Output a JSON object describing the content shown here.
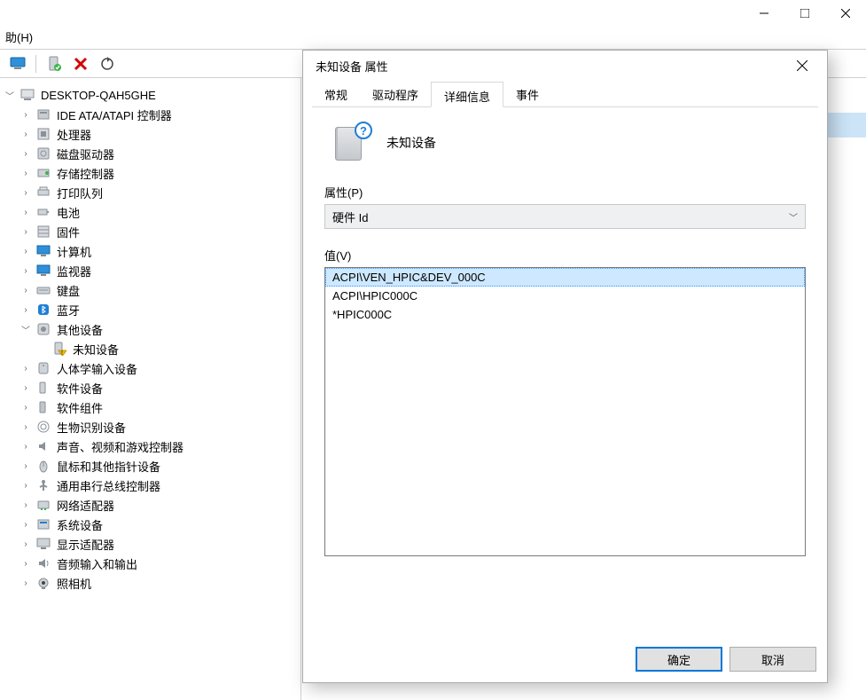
{
  "window": {
    "min_tip": "Minimize",
    "max_tip": "Restore",
    "close_tip": "Close"
  },
  "menu": {
    "help": "助(H)"
  },
  "toolbar": {
    "monitor": "monitor",
    "scan": "scan",
    "delete": "delete",
    "refresh": "refresh"
  },
  "tree": {
    "root": "DESKTOP-QAH5GHE",
    "items": [
      {
        "icon": "ide",
        "label": "IDE ATA/ATAPI 控制器"
      },
      {
        "icon": "cpu",
        "label": "处理器"
      },
      {
        "icon": "disk",
        "label": "磁盘驱动器"
      },
      {
        "icon": "storage",
        "label": "存储控制器"
      },
      {
        "icon": "printer",
        "label": "打印队列"
      },
      {
        "icon": "battery",
        "label": "电池"
      },
      {
        "icon": "firmware",
        "label": "固件"
      },
      {
        "icon": "computer",
        "label": "计算机"
      },
      {
        "icon": "monitor",
        "label": "监视器"
      },
      {
        "icon": "keyboard",
        "label": "键盘"
      },
      {
        "icon": "bluetooth",
        "label": "蓝牙"
      }
    ],
    "other_devices_label": "其他设备",
    "unknown_device_label": "未知设备",
    "items2": [
      {
        "icon": "hid",
        "label": "人体学输入设备"
      },
      {
        "icon": "softdev",
        "label": "软件设备"
      },
      {
        "icon": "softcomp",
        "label": "软件组件"
      },
      {
        "icon": "biometric",
        "label": "生物识别设备"
      },
      {
        "icon": "sound",
        "label": "声音、视频和游戏控制器"
      },
      {
        "icon": "mouse",
        "label": "鼠标和其他指针设备"
      },
      {
        "icon": "usb",
        "label": "通用串行总线控制器"
      },
      {
        "icon": "network",
        "label": "网络适配器"
      },
      {
        "icon": "system",
        "label": "系统设备"
      },
      {
        "icon": "display",
        "label": "显示适配器"
      },
      {
        "icon": "audio",
        "label": "音频输入和输出"
      },
      {
        "icon": "camera",
        "label": "照相机"
      }
    ]
  },
  "dialog": {
    "title": "未知设备 属性",
    "device_label": "未知设备",
    "tabs": {
      "general": "常规",
      "driver": "驱动程序",
      "details": "详细信息",
      "events": "事件"
    },
    "prop_label": "属性(P)",
    "prop_value": "硬件 Id",
    "value_label": "值(V)",
    "values": [
      "ACPI\\VEN_HPIC&DEV_000C",
      "ACPI\\HPIC000C",
      "*HPIC000C"
    ],
    "ok": "确定",
    "cancel": "取消"
  }
}
